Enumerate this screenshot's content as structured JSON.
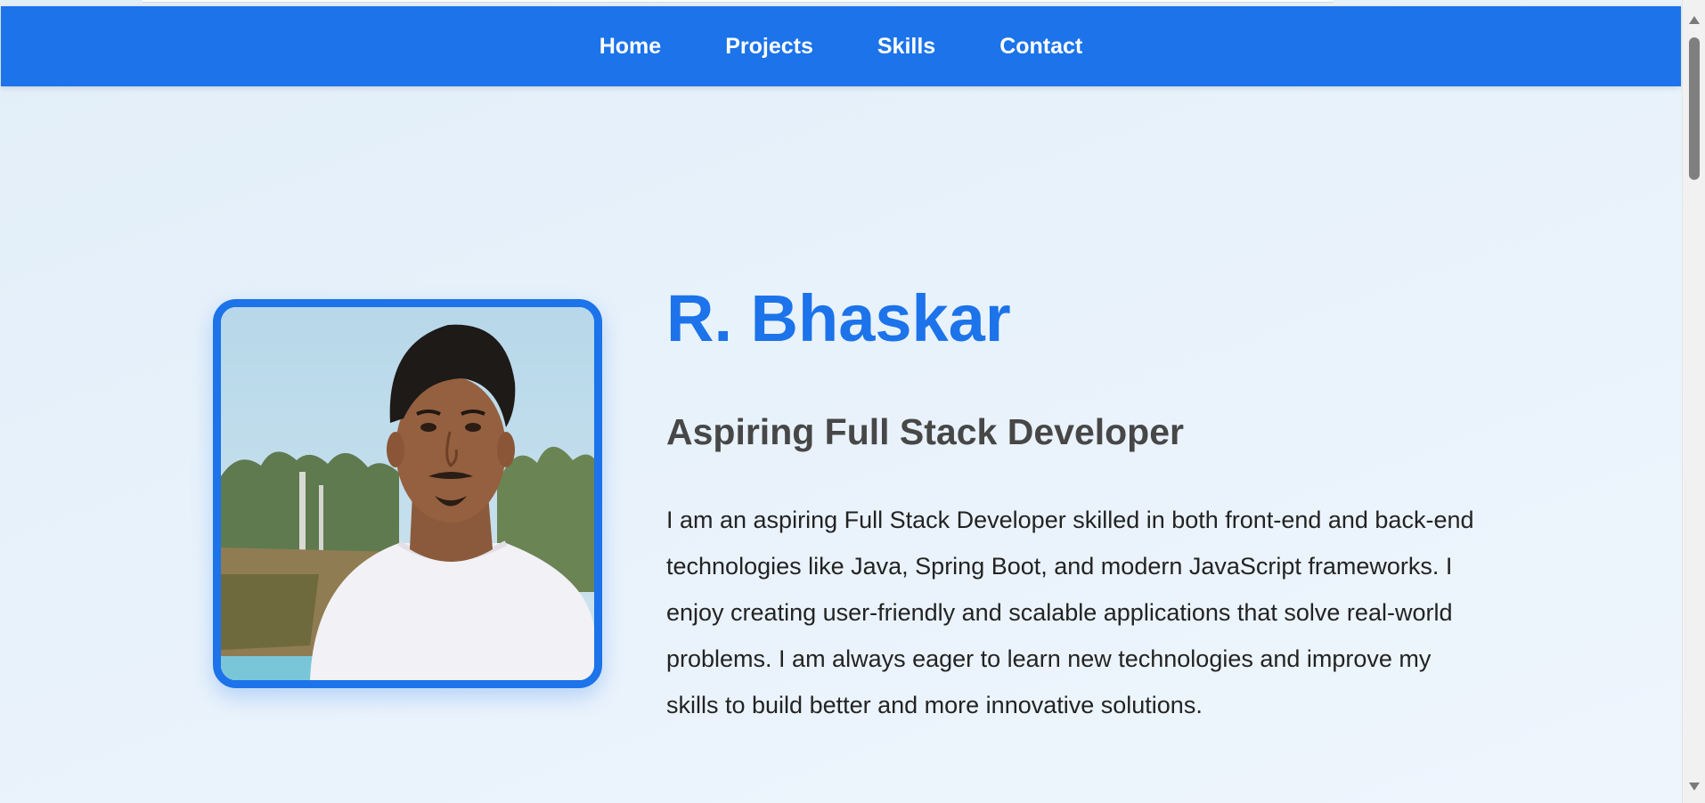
{
  "nav": {
    "items": [
      {
        "label": "Home"
      },
      {
        "label": "Projects"
      },
      {
        "label": "Skills"
      },
      {
        "label": "Contact"
      }
    ]
  },
  "hero": {
    "name": "R. Bhaskar",
    "role": "Aspiring Full Stack Developer",
    "bio": "I am an aspiring Full Stack Developer skilled in both front-end and back-end technologies like Java, Spring Boot, and modern JavaScript frameworks. I enjoy creating user-friendly and scalable applications that solve real-world problems. I am always eager to learn new technologies and improve my skills to build better and more innovative solutions."
  },
  "colors": {
    "accent": "#1c73ea",
    "name_text": "#1c73ea",
    "role_text": "#474747",
    "body_text": "#232323"
  },
  "icons": {
    "scroll_up": "scroll-up-arrow-icon",
    "scroll_down": "scroll-down-arrow-icon"
  }
}
